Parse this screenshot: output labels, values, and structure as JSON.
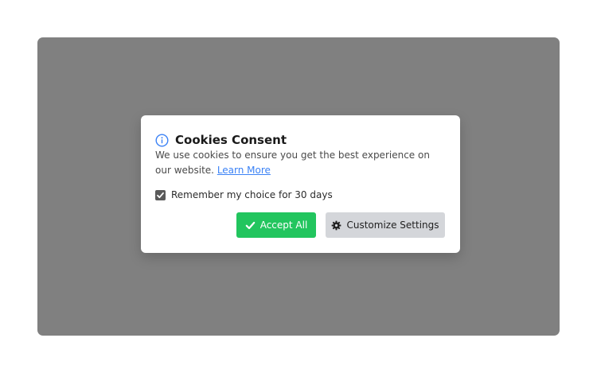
{
  "modal": {
    "title": "Cookies Consent",
    "description": "We use cookies to ensure you get the best experience on our website.",
    "learn_more": "Learn More",
    "remember_label": "Remember my choice for 30 days",
    "remember_checked": true,
    "accept_label": "Accept All",
    "customize_label": "Customize Settings",
    "icons": {
      "title": "info-icon",
      "accept": "check-icon",
      "customize": "gear-icon",
      "checkbox": "check-icon"
    }
  },
  "colors": {
    "overlay": "#808080",
    "accept": "#22c55e",
    "customize": "#d4d6da",
    "link": "#3b82f6",
    "info": "#3b82f6"
  }
}
